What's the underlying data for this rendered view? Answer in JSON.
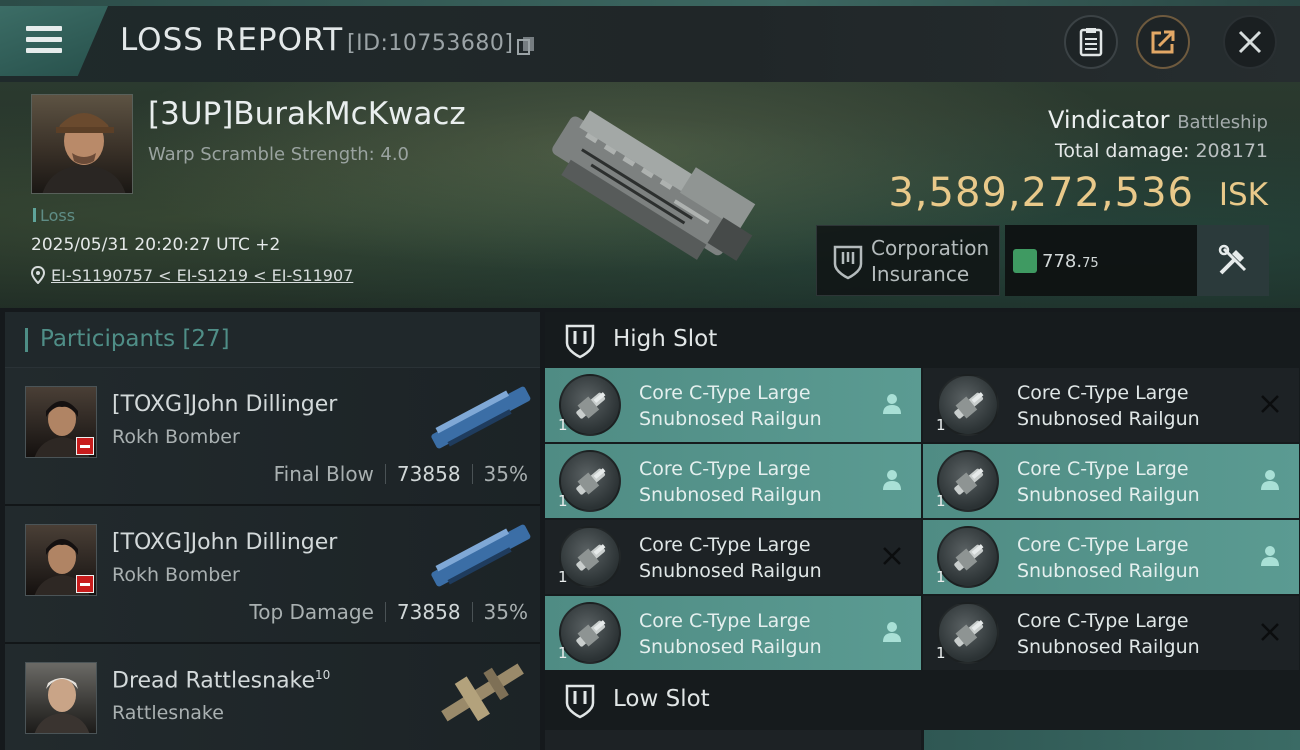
{
  "header": {
    "title": "LOSS REPORT",
    "report_id": "[ID:10753680]",
    "buttons": [
      "clipboard-icon",
      "share-icon",
      "close-icon"
    ]
  },
  "victim": {
    "name": "[3UP]BurakMcKwacz",
    "warp_scramble": "Warp Scramble Strength: 4.0",
    "tag": "Loss",
    "datetime": "2025/05/31 20:20:27 UTC +2",
    "location": "EI-S1190757 < EI-S1219 < EI-S11907",
    "ship_name": "Vindicator",
    "ship_class": "Battleship",
    "total_damage_label": "Total damage:",
    "total_damage": "208171",
    "isk_value": "3,589,272,536",
    "isk_unit": "ISK",
    "insurance_label_1": "Corporation",
    "insurance_label_2": "Insurance",
    "insurance_value_main": "778.",
    "insurance_value_dec": "75"
  },
  "participants": {
    "label": "Participants",
    "count": "[27]",
    "rows": [
      {
        "name": "[TOXG]John Dillinger",
        "ship": "Rokh Bomber",
        "role": "Final Blow",
        "damage": "73858",
        "percent": "35%"
      },
      {
        "name": "[TOXG]John Dillinger",
        "ship": "Rokh Bomber",
        "role": "Top Damage",
        "damage": "73858",
        "percent": "35%"
      },
      {
        "name": "Dread Rattlesnake",
        "name_sup": "10",
        "ship": "Rattlesnake"
      }
    ]
  },
  "slots": {
    "high_label": "High Slot",
    "low_label": "Low Slot",
    "high_modules": [
      {
        "name_1": "Core C-Type Large",
        "name_2": "Snubnosed Railgun",
        "qty": "1",
        "state": "dropped"
      },
      {
        "name_1": "Core C-Type Large",
        "name_2": "Snubnosed Railgun",
        "qty": "1",
        "state": "destroyed"
      },
      {
        "name_1": "Core C-Type Large",
        "name_2": "Snubnosed Railgun",
        "qty": "1",
        "state": "dropped"
      },
      {
        "name_1": "Core C-Type Large",
        "name_2": "Snubnosed Railgun",
        "qty": "1",
        "state": "dropped"
      },
      {
        "name_1": "Core C-Type Large",
        "name_2": "Snubnosed Railgun",
        "qty": "1",
        "state": "destroyed"
      },
      {
        "name_1": "Core C-Type Large",
        "name_2": "Snubnosed Railgun",
        "qty": "1",
        "state": "dropped"
      },
      {
        "name_1": "Core C-Type Large",
        "name_2": "Snubnosed Railgun",
        "qty": "1",
        "state": "dropped"
      },
      {
        "name_1": "Core C-Type Large",
        "name_2": "Snubnosed Railgun",
        "qty": "1",
        "state": "destroyed"
      }
    ]
  },
  "colors": {
    "accent": "#5b9b92",
    "isk": "#e9c98a",
    "loss_red": "#c81c1c",
    "fitting_green": "#3f9a62"
  }
}
